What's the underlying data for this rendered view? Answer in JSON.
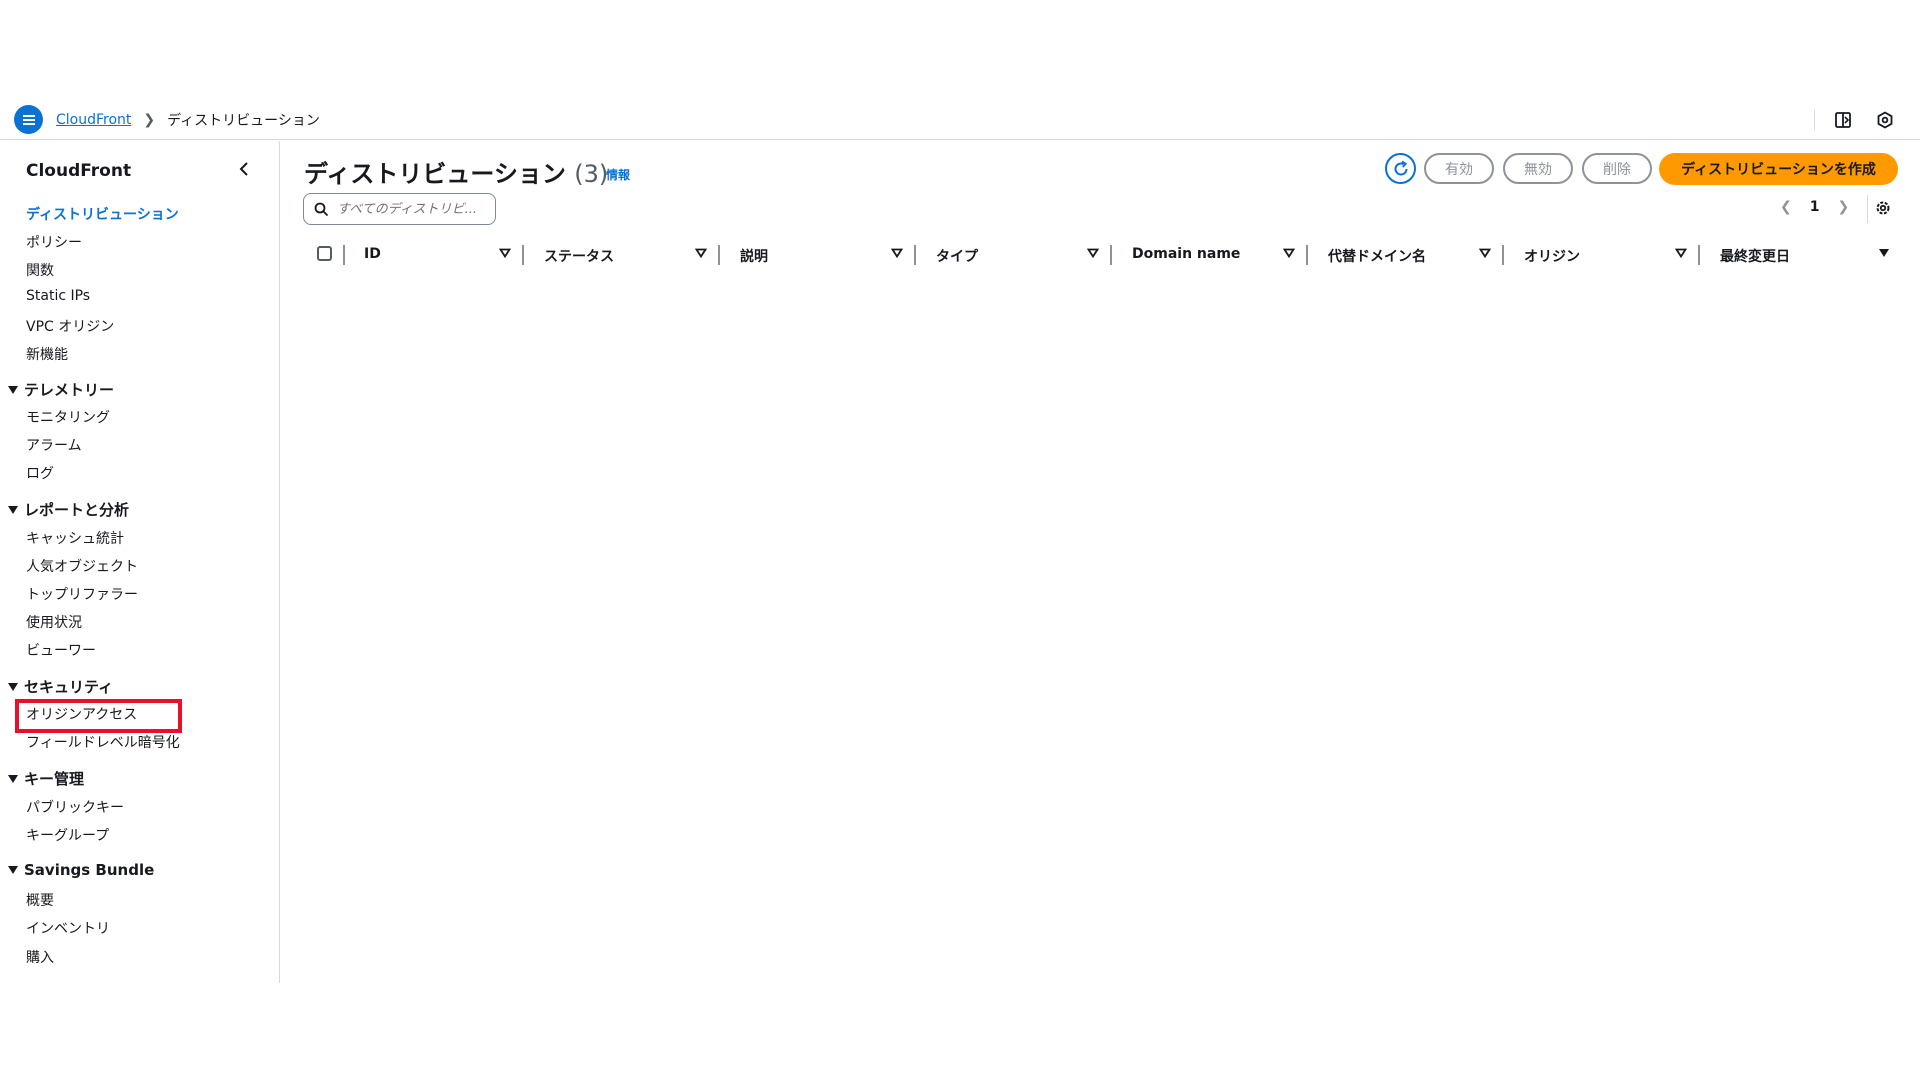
{
  "breadcrumb": {
    "service": "CloudFront",
    "current": "ディストリビューション"
  },
  "sidebar": {
    "title": "CloudFront",
    "items_top": [
      "ディストリビューション",
      "ポリシー",
      "関数",
      "Static IPs",
      "VPC オリジン",
      "新機能"
    ],
    "sections": [
      {
        "label": "テレメトリー",
        "items": [
          "モニタリング",
          "アラーム",
          "ログ"
        ]
      },
      {
        "label": "レポートと分析",
        "items": [
          "キャッシュ統計",
          "人気オブジェクト",
          "トップリファラー",
          "使用状況",
          "ビューワー"
        ]
      },
      {
        "label": "セキュリティ",
        "items": [
          "オリジンアクセス",
          "フィールドレベル暗号化"
        ]
      },
      {
        "label": "キー管理",
        "items": [
          "パブリックキー",
          "キーグループ"
        ]
      },
      {
        "label": "Savings Bundle",
        "items": [
          "概要",
          "インベントリ",
          "購入"
        ]
      }
    ]
  },
  "main": {
    "title": "ディストリビューション",
    "count": "(3)",
    "info": "情報",
    "buttons": {
      "enable": "有効",
      "disable": "無効",
      "delete": "削除",
      "create": "ディストリビューションを作成"
    },
    "search_placeholder": "すべてのディストリビ...",
    "page": "1",
    "columns": [
      "ID",
      "ステータス",
      "説明",
      "タイプ",
      "Domain name",
      "代替ドメイン名",
      "オリジン",
      "最終変更日"
    ]
  },
  "colors": {
    "accent": "#0972d3",
    "primary_button": "#ff9900",
    "highlight": "#e8112d"
  }
}
